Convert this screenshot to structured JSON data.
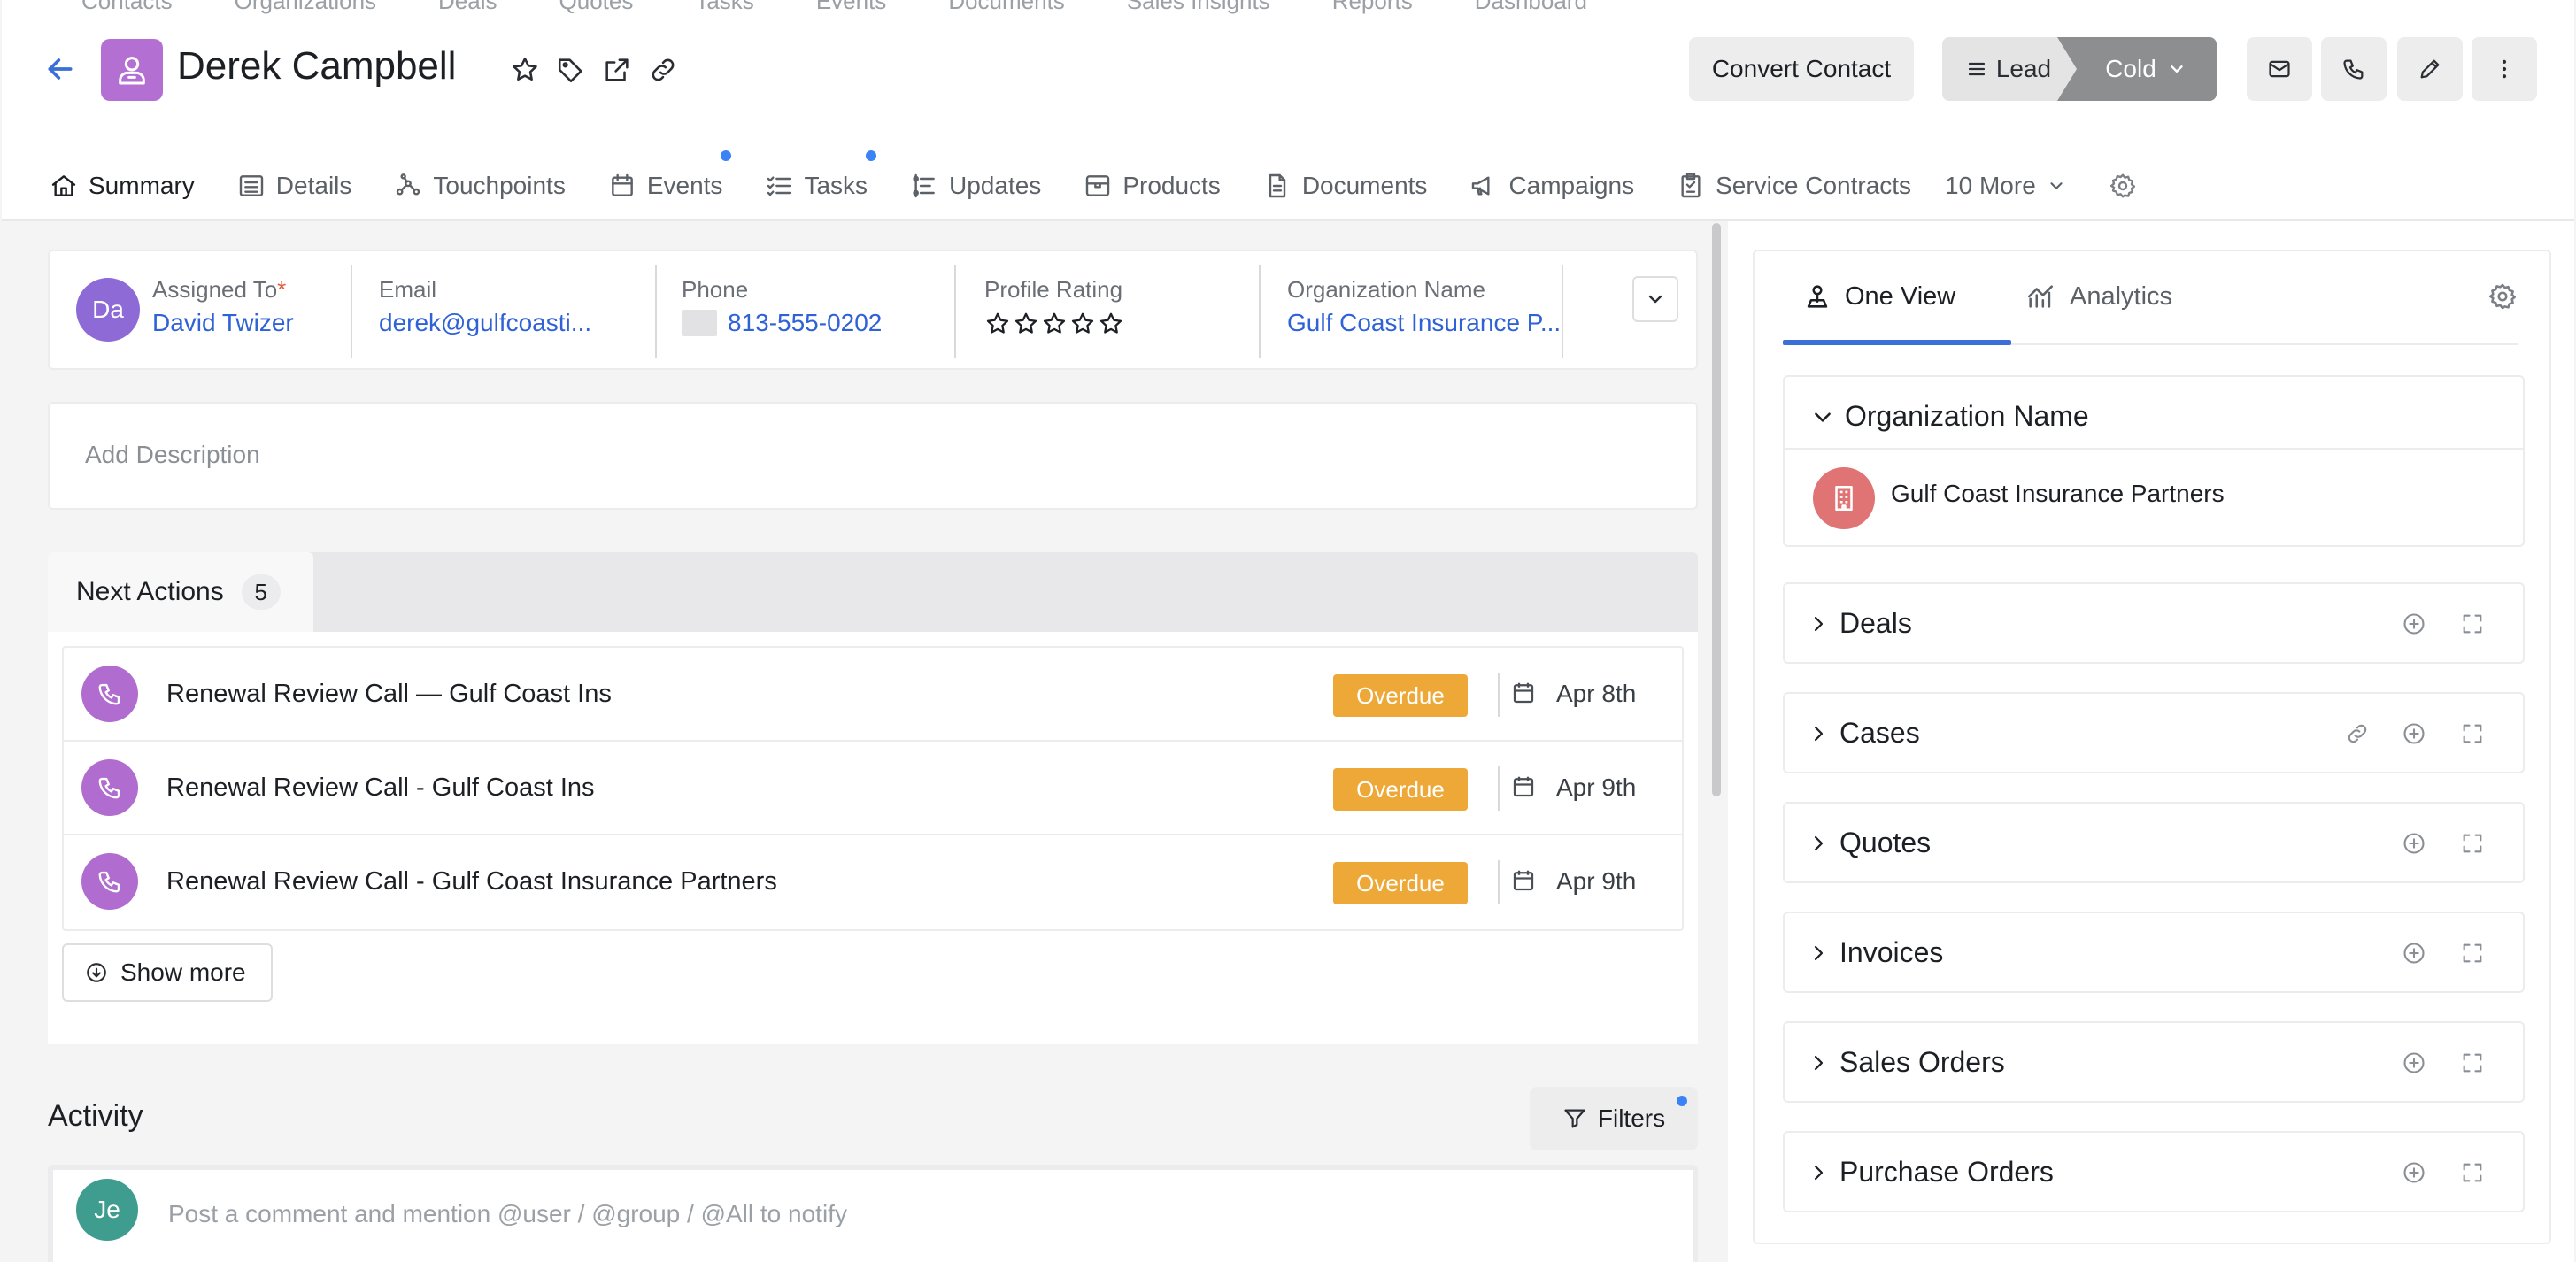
{
  "top_nav_remnant": [
    "Contacts",
    "Organizations",
    "Deals",
    "Quotes",
    "Tasks",
    "Events",
    "Documents",
    "Sales Insights",
    "Reports",
    "Dashboard"
  ],
  "header": {
    "contact_name": "Derek Campbell",
    "convert_label": "Convert Contact",
    "stage_lead": "Lead",
    "stage_cold": "Cold"
  },
  "tabs": [
    {
      "label": "Summary",
      "icon": "home-icon",
      "active": true,
      "dot": false
    },
    {
      "label": "Details",
      "icon": "list-icon",
      "active": false,
      "dot": false
    },
    {
      "label": "Touchpoints",
      "icon": "touchpoints-icon",
      "active": false,
      "dot": false
    },
    {
      "label": "Events",
      "icon": "calendar-icon",
      "active": false,
      "dot": true
    },
    {
      "label": "Tasks",
      "icon": "tasks-icon",
      "active": false,
      "dot": true
    },
    {
      "label": "Updates",
      "icon": "updates-icon",
      "active": false,
      "dot": false
    },
    {
      "label": "Products",
      "icon": "box-icon",
      "active": false,
      "dot": false
    },
    {
      "label": "Documents",
      "icon": "document-icon",
      "active": false,
      "dot": false
    },
    {
      "label": "Campaigns",
      "icon": "megaphone-icon",
      "active": false,
      "dot": false
    },
    {
      "label": "Service Contracts",
      "icon": "contract-icon",
      "active": false,
      "dot": false
    }
  ],
  "more_tabs_label": "10 More",
  "info": {
    "assignee_initials": "Da",
    "assigned_label": "Assigned To",
    "required_mark": "*",
    "assigned_value": "David Twizer",
    "email_label": "Email",
    "email_value": "derek@gulfcoasti...",
    "phone_label": "Phone",
    "phone_value": "813-555-0202",
    "rating_label": "Profile Rating",
    "rating": 0,
    "rating_max": 5,
    "org_label": "Organization Name",
    "org_value": "Gulf Coast Insurance P..."
  },
  "description_placeholder": "Add Description",
  "next_actions": {
    "label": "Next Actions",
    "count": "5",
    "items": [
      {
        "title": "Renewal Review Call — Gulf Coast Ins",
        "status": "Overdue",
        "date": "Apr 8th"
      },
      {
        "title": "Renewal Review Call - Gulf Coast Ins",
        "status": "Overdue",
        "date": "Apr 9th"
      },
      {
        "title": "Renewal Review Call - Gulf Coast Insurance Partners",
        "status": "Overdue",
        "date": "Apr 9th"
      }
    ],
    "show_more": "Show more"
  },
  "activity": {
    "title": "Activity",
    "filters_label": "Filters",
    "commenter_initials": "Je",
    "comment_placeholder": "Post a comment and mention @user / @group / @All to notify"
  },
  "right_panel": {
    "tab_one_view": "One View",
    "tab_analytics": "Analytics",
    "org_section_title": "Organization Name",
    "org_name": "Gulf Coast Insurance Partners",
    "sections": [
      {
        "title": "Deals",
        "link": false
      },
      {
        "title": "Cases",
        "link": true
      },
      {
        "title": "Quotes",
        "link": false
      },
      {
        "title": "Invoices",
        "link": false
      },
      {
        "title": "Sales Orders",
        "link": false
      },
      {
        "title": "Purchase Orders",
        "link": false
      }
    ]
  },
  "colors": {
    "accent": "#3b6fd8",
    "link": "#2f62d6",
    "overdue": "#eea838",
    "contact_avatar": "#b46fd3",
    "org_avatar": "#e07373",
    "call_icon": "#b06ccf"
  }
}
